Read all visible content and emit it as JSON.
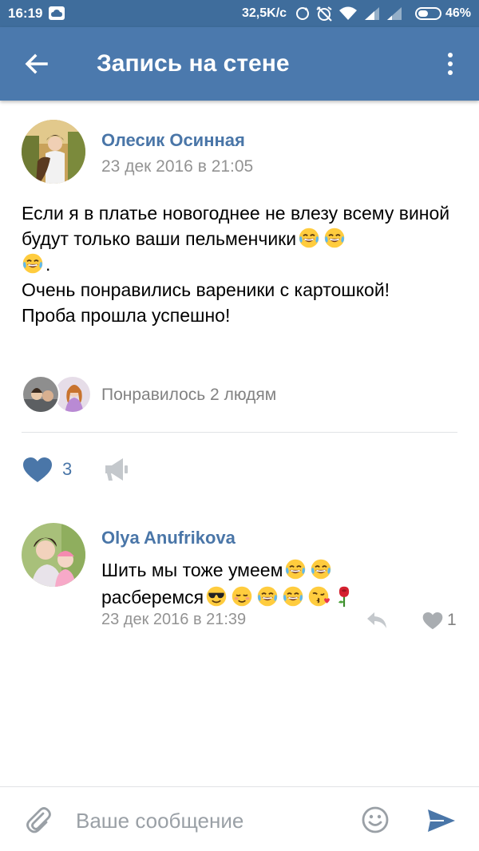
{
  "status_bar": {
    "time": "16:19",
    "network_speed": "32,5K/c",
    "battery_percent": "46%",
    "battery_level": 0.46,
    "icons": [
      "cloud-icon",
      "sync-icon",
      "alarm-off-icon",
      "wifi-icon",
      "signal-icon",
      "signal-icon"
    ]
  },
  "app_bar": {
    "title": "Запись на стене",
    "back_icon": "arrow-back-icon",
    "menu_icon": "more-vert-icon"
  },
  "post": {
    "author": "Олесик Осинная",
    "date": "23 дек 2016 в 21:05",
    "text_line1": "Если я в платье новогоднее не влезу всему виной будут только ваши пельменчики",
    "text_line1_end": ".",
    "text_line2": "Очень понравились вареники с картошкой!",
    "text_line3": "Проба прошла успешно!",
    "likes_text": "Понравилось 2 людям",
    "like_count": "3",
    "emojis": [
      "laughing-tears-emoji",
      "laughing-tears-emoji",
      "laughing-tears-emoji"
    ]
  },
  "comment": {
    "author": "Olya Anufrikova",
    "text_line1": "Шить мы тоже умеем",
    "text_line2": "расберемся",
    "date": "23 дек 2016 в 21:39",
    "like_count": "1",
    "emojis": [
      "laughing-tears-emoji",
      "laughing-tears-emoji",
      "sunglasses-emoji",
      "smiling-emoji",
      "laughing-tears-emoji",
      "laughing-tears-emoji",
      "kissing-heart-emoji",
      "rose-emoji"
    ]
  },
  "composer": {
    "placeholder": "Ваше сообщение"
  },
  "colors": {
    "status_bar": "#3f6d9c",
    "app_bar": "#4b79ad",
    "link": "#4a76a8",
    "secondary_text": "#939393",
    "icon_gray": "#c4c8cc"
  }
}
